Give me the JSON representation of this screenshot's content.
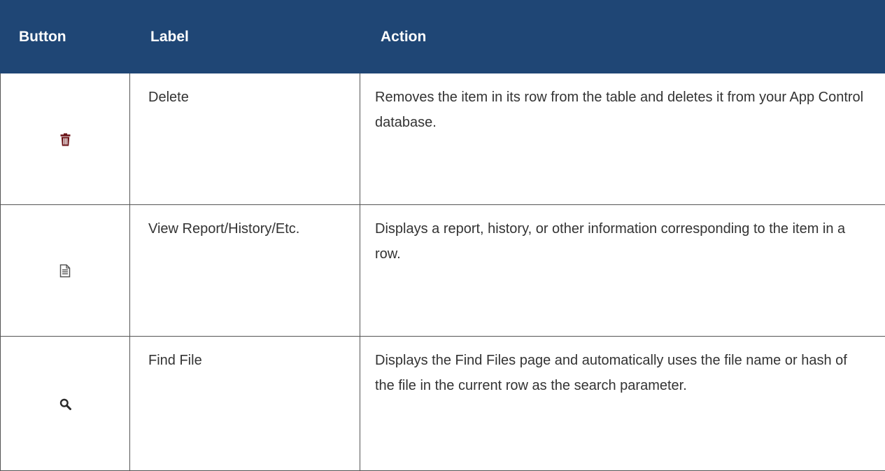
{
  "table": {
    "headers": {
      "button": "Button",
      "label": "Label",
      "action": "Action"
    },
    "rows": [
      {
        "icon": "trash-icon",
        "label": "Delete",
        "action": "Removes the item in its row from the table and deletes it from your App Control database."
      },
      {
        "icon": "document-icon",
        "label": "View Report/History/Etc.",
        "action": "Displays a report, history, or other information corresponding to the item in a row."
      },
      {
        "icon": "search-icon",
        "label": "Find File",
        "action": "Displays the Find Files page and automatically uses the file name or hash of the file in the current row as the search parameter."
      }
    ]
  },
  "colors": {
    "header_bg": "#1f4675",
    "header_text": "#ffffff",
    "body_text": "#333333",
    "trash_icon": "#6b1418"
  }
}
